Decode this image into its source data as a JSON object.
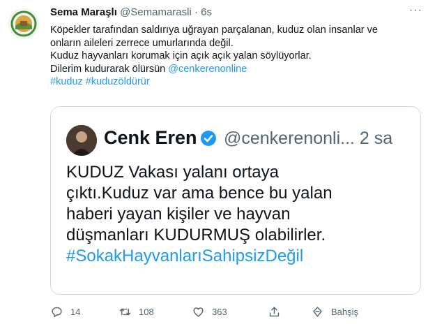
{
  "tweet": {
    "author_name": "Sema Maraşlı",
    "author_handle": "@Semamarasli",
    "separator": "·",
    "time": "6s",
    "more_icon": "more-icon",
    "lines": [
      "Köpekler tarafından saldırıya uğrayan parçalanan, kuduz olan insanlar ve",
      "onların aileleri zerrece umurlarında değil.",
      "Kuduz hayvanları korumak için açık açık yalan söylüyorlar."
    ],
    "line4_text": "Dilerim kudurarak ölürsün ",
    "line4_mention": "@cenkerenonline",
    "hashtags": [
      "#kuduz",
      "#kuduzöldürür"
    ]
  },
  "quoted": {
    "name": "Cenk Eren",
    "handle_time": "@cenkerenonli... 2 sa",
    "verified_icon": "verified-badge-icon",
    "lines": [
      "KUDUZ Vakası yalanı ortaya",
      "çıktı.Kuduz var ama bence bu yalan",
      "haberi yayan kişiler ve hayvan",
      "düşmanları KUDURMUŞ olabilirler."
    ],
    "hashtag": "#SokakHayvanlarıSahipsizDeğil"
  },
  "actions": {
    "reply_count": "14",
    "retweet_count": "108",
    "like_count": "363",
    "share_icon": "share-icon",
    "tip_label": "Bahşiş"
  },
  "colors": {
    "link": "#1d9bf0",
    "text": "#0f1419",
    "secondary": "#536471",
    "border": "#cfd9de"
  }
}
